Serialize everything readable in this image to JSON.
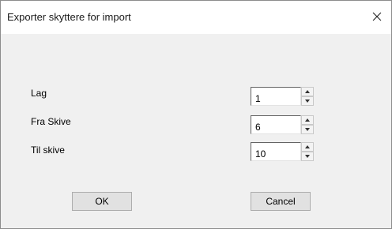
{
  "window": {
    "title": "Exporter skyttere for import"
  },
  "fields": [
    {
      "label": "Lag",
      "value": "1"
    },
    {
      "label": "Fra Skive",
      "value": "6"
    },
    {
      "label": "Til skive",
      "value": "10"
    }
  ],
  "buttons": {
    "ok_label": "OK",
    "cancel_label": "Cancel"
  },
  "icons": {
    "close": "close-icon",
    "up": "up-arrow-icon",
    "down": "down-arrow-icon"
  }
}
